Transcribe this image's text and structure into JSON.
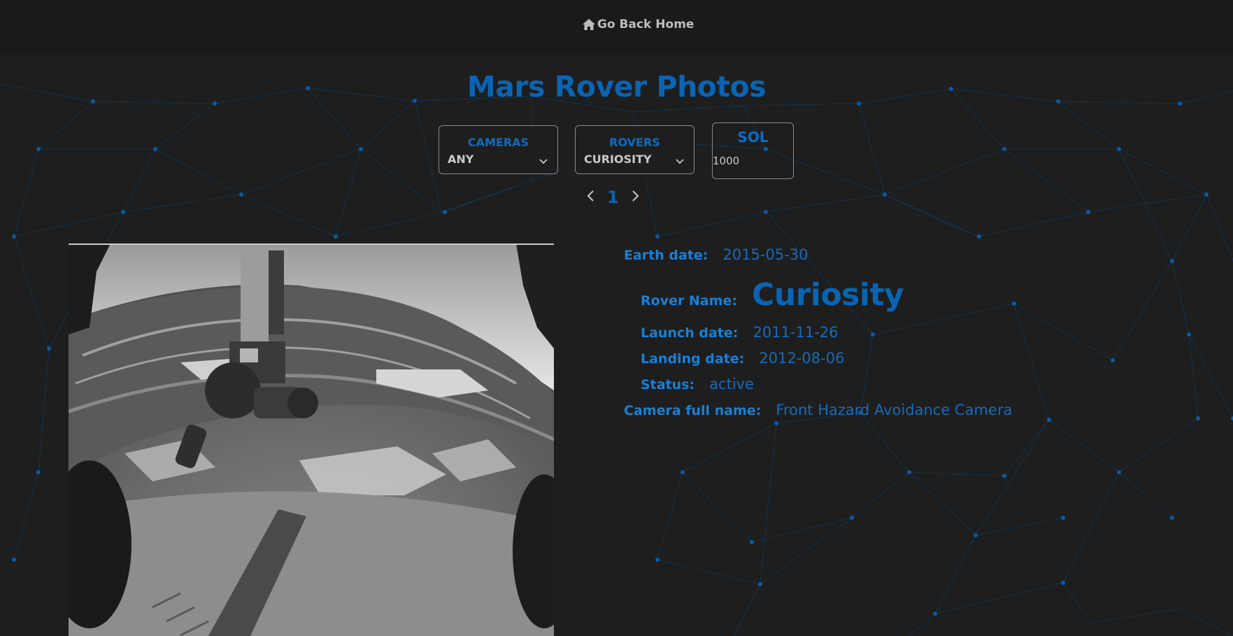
{
  "nav": {
    "home_label": "Go Back Home",
    "home_icon": "home-icon"
  },
  "title": "Mars Rover Photos",
  "filters": {
    "cameras": {
      "label": "CAMERAS",
      "value": "ANY"
    },
    "rovers": {
      "label": "ROVERS",
      "value": "CURIOSITY"
    },
    "sol": {
      "label": "SOL",
      "value": "1000"
    }
  },
  "pagination": {
    "page": "1"
  },
  "photo_info": {
    "earth_date_label": "Earth date:",
    "earth_date": "2015-05-30",
    "rover_name_label": "Rover Name:",
    "rover_name": "Curiosity",
    "launch_date_label": "Launch date:",
    "launch_date": "2011-11-26",
    "landing_date_label": "Landing date:",
    "landing_date": "2012-08-06",
    "status_label": "Status:",
    "status": "active",
    "camera_full_name_label": "Camera full name:",
    "camera_full_name": "Front Hazard Avoidance Camera"
  },
  "colors": {
    "background": "#1e1e1e",
    "topbar": "#1a1a1a",
    "accent": "#0a64b4",
    "label_blue": "#1a7fd6",
    "network_lines": "#0d3d66"
  }
}
